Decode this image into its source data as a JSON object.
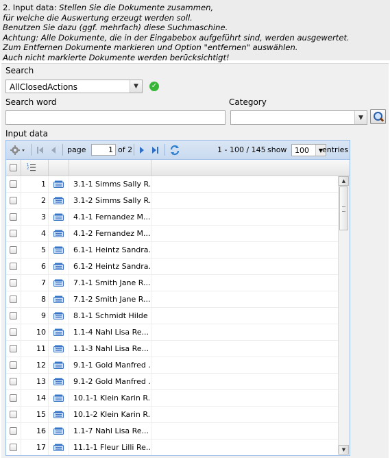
{
  "intro": {
    "label": "2. Input data: ",
    "lines": [
      "Stellen Sie die Dokumente zusammen,",
      "für welche die Auswertung erzeugt werden soll.",
      "Benutzen Sie dazu (ggf. mehrfach) diese Suchmaschine.",
      "Achtung: Alle Dokumente, die in der Eingabebox aufgeführt sind, werden ausgewertet.",
      "Zum Entfernen Dokumente markieren und Option \"entfernen\" auswählen.",
      "Auch nicht markierte Dokumente werden berücksichtigt!"
    ]
  },
  "search": {
    "label": "Search",
    "selected": "AllClosedActions",
    "search_word_label": "Search word",
    "search_word_value": "",
    "category_label": "Category",
    "category_value": ""
  },
  "input_data": {
    "label": "Input data",
    "pager": {
      "page_label": "page",
      "page_value": "1",
      "of_label": "of 2",
      "range": "1 - 100 / 145",
      "show_label": "show",
      "show_value": "100",
      "entries_label": "entries"
    },
    "rows": [
      {
        "n": "1",
        "name": "3.1-1 Simms Sally R..."
      },
      {
        "n": "2",
        "name": "3.1-2 Simms Sally R..."
      },
      {
        "n": "3",
        "name": "4.1-1 Fernandez M..."
      },
      {
        "n": "4",
        "name": "4.1-2 Fernandez M..."
      },
      {
        "n": "5",
        "name": "6.1-1 Heintz Sandra..."
      },
      {
        "n": "6",
        "name": "6.1-2 Heintz Sandra..."
      },
      {
        "n": "7",
        "name": "7.1-1 Smith Jane R..."
      },
      {
        "n": "8",
        "name": "7.1-2 Smith Jane R..."
      },
      {
        "n": "9",
        "name": "8.1-1 Schmidt Hilde ..."
      },
      {
        "n": "10",
        "name": "1.1-4 Nahl Lisa Re..."
      },
      {
        "n": "11",
        "name": "1.1-3 Nahl Lisa Re..."
      },
      {
        "n": "12",
        "name": "9.1-1 Gold Manfred ..."
      },
      {
        "n": "13",
        "name": "9.1-2 Gold Manfred ..."
      },
      {
        "n": "14",
        "name": "10.1-1 Klein Karin R..."
      },
      {
        "n": "15",
        "name": "10.1-2 Klein Karin R..."
      },
      {
        "n": "16",
        "name": "1.1-7 Nahl Lisa Re..."
      },
      {
        "n": "17",
        "name": "11.1-1 Fleur Lilli Re..."
      }
    ]
  },
  "colors": {
    "accent": "#99bbe8",
    "ok_green": "#36b536",
    "doc_icon": "#3a74c4"
  },
  "icons": [
    "check-circle-icon",
    "magnifier-icon",
    "gear-icon",
    "first-page-icon",
    "prev-page-icon",
    "next-page-icon",
    "last-page-icon",
    "refresh-icon",
    "numbered-list-icon",
    "document-icon"
  ]
}
